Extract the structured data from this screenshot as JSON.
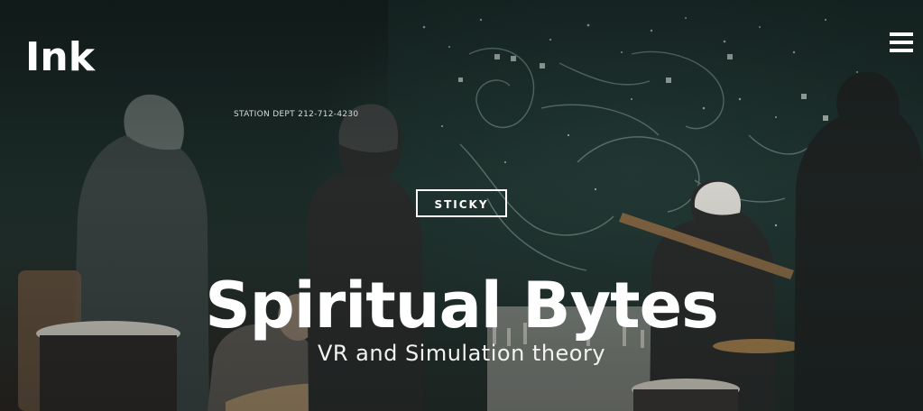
{
  "site": {
    "logo": "Ink"
  },
  "header": {
    "menu_icon": "hamburger-menu-icon"
  },
  "hero": {
    "tag_label": "STICKY",
    "title": "Spiritual Bytes",
    "subtitle": "VR and Simulation theory",
    "background_text": "STATION DEPT 212-712-4230"
  },
  "colors": {
    "text": "#ffffff",
    "background": "#1b2b28",
    "mural_tint": "#3a5c56"
  }
}
